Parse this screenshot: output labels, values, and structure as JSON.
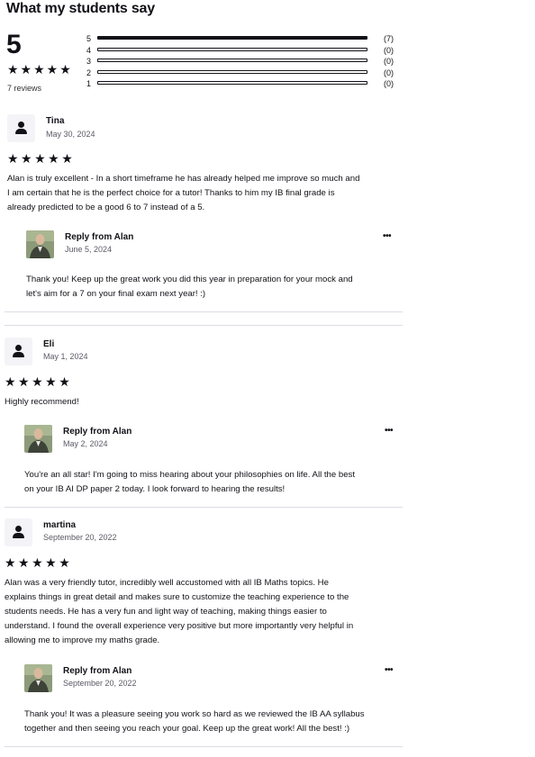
{
  "section_title": "What my students say",
  "summary": {
    "rating": "5",
    "stars": "★★★★★",
    "reviews_label": "7 reviews",
    "distribution": [
      {
        "star": "5",
        "count": "(7)",
        "fraction": 1.0
      },
      {
        "star": "4",
        "count": "(0)",
        "fraction": 0
      },
      {
        "star": "3",
        "count": "(0)",
        "fraction": 0
      },
      {
        "star": "2",
        "count": "(0)",
        "fraction": 0
      },
      {
        "star": "1",
        "count": "(0)",
        "fraction": 0
      }
    ]
  },
  "reviews": [
    {
      "name": "Tina",
      "date": "May 30, 2024",
      "stars": "★★★★★",
      "text_lines": [
        "Alan is truly excellent - In a short timeframe he has already helped me improve so much and",
        "I am certain that he is the perfect choice for a tutor! Thanks to him my IB final grade is",
        "already predicted to be a good 6 to 7 instead of a 5."
      ],
      "reply": {
        "label": "Reply from Alan",
        "date": "June 5, 2024",
        "more": "•••",
        "text_lines": [
          "Thank you! Keep up the great work you did this year in preparation for your mock and",
          "let's aim for a 7 on your final exam next year! :)"
        ]
      }
    },
    {
      "name": "Eli",
      "date": "May 1, 2024",
      "stars": "★★★★★",
      "text_lines": [
        "Highly recommend!"
      ],
      "reply": {
        "label": "Reply from Alan",
        "date": "May 2, 2024",
        "more": "•••",
        "text_lines": [
          "You're an all star! I'm going to miss hearing about your philosophies on life. All the best",
          "on your IB AI DP paper 2 today. I look forward to hearing the results!"
        ]
      }
    },
    {
      "name": "martina",
      "date": "September 20, 2022",
      "stars": "★★★★★",
      "text_lines": [
        "Alan was a very friendly tutor, incredibly well accustomed with all IB Maths topics. He",
        "explains things in great detail and makes sure to customize the teaching experience to the",
        "students needs. He has a very fun and light way of teaching, making things easier to",
        "understand. I found the overall experience very positive but more importantly very helpful in",
        "allowing me to improve my maths grade."
      ],
      "reply": {
        "label": "Reply from Alan",
        "date": "September 20, 2022",
        "more": "•••",
        "text_lines": [
          "Thank you! It was a pleasure seeing you work so hard as we reviewed the IB AA syllabus",
          "together and then seeing you reach your goal. Keep up the great work! All the best! :)"
        ]
      }
    }
  ]
}
